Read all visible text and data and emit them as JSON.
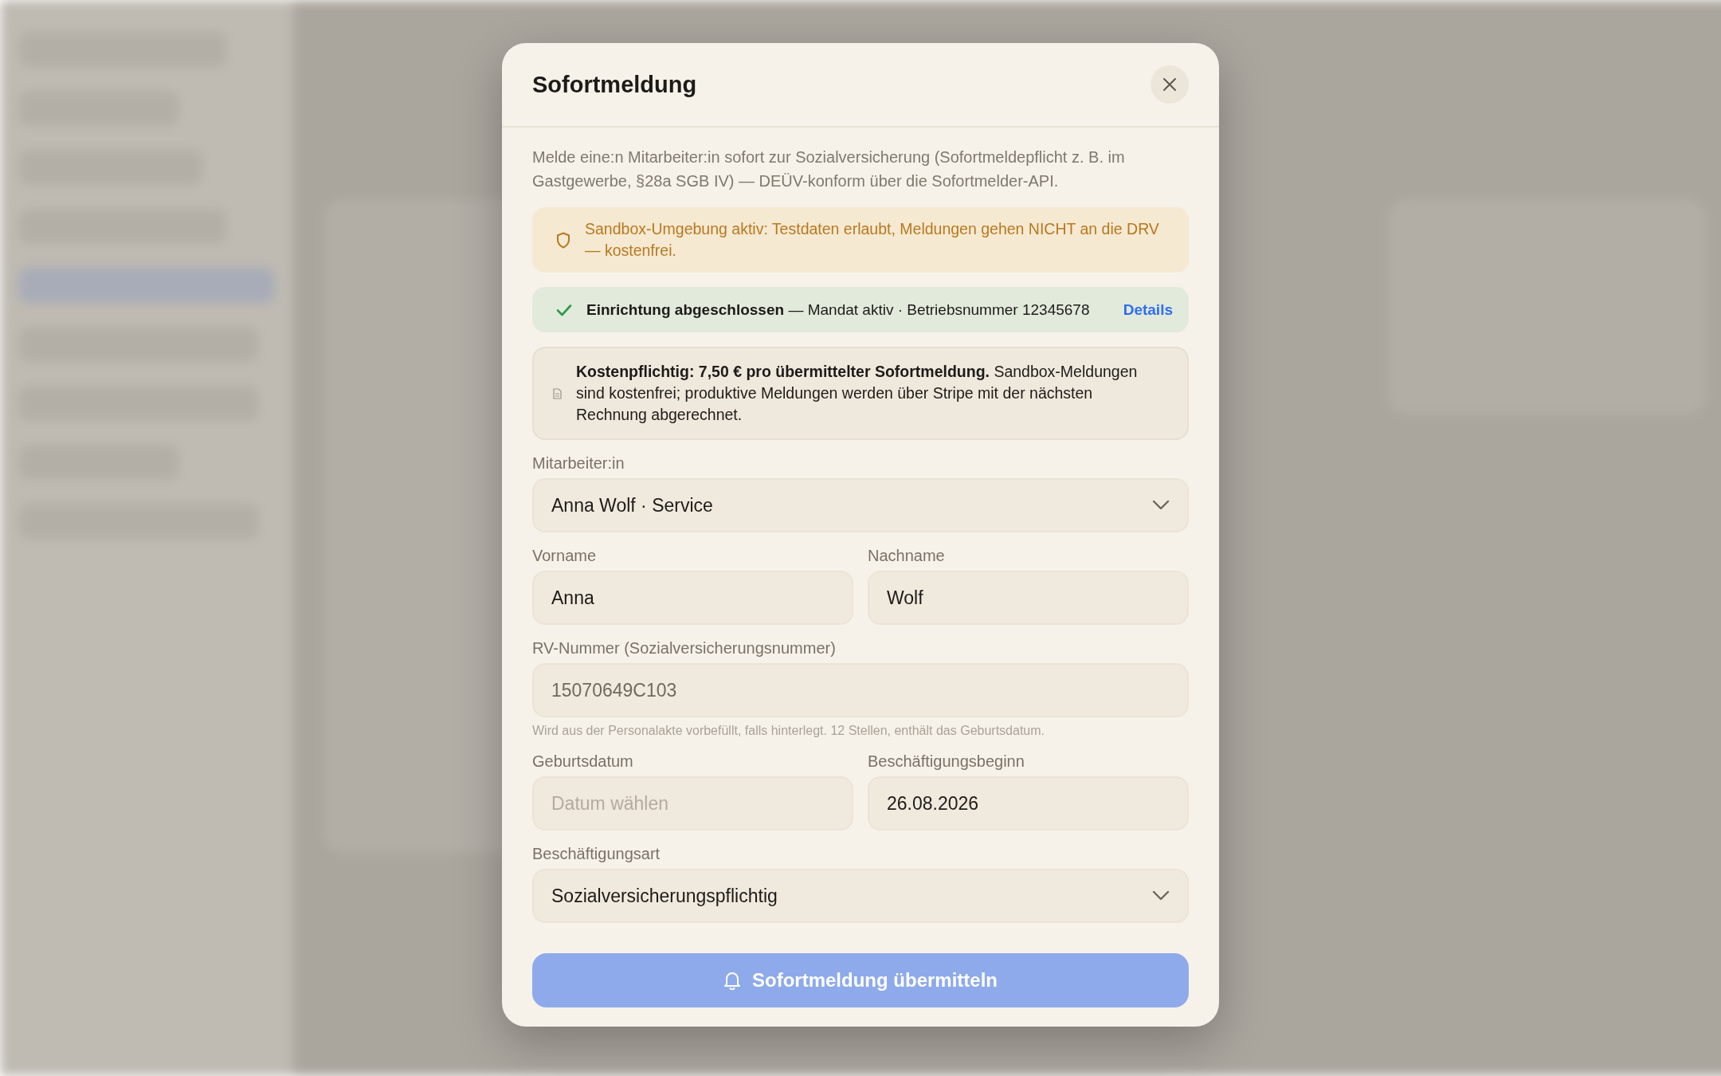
{
  "dialog": {
    "title": "Sofortmeldung",
    "intro": "Melde eine:n Mitarbeiter:in sofort zur Sozialversicherung (Sofortmeldepflicht z. B. im Gastgewerbe, §28a SGB IV) — DEÜV-konform über die Sofortmelder-API.",
    "notices": [
      {
        "kind": "warning",
        "text": "Sandbox-Umgebung aktiv: Testdaten erlaubt, Meldungen gehen NICHT an die DRV — kostenfrei."
      },
      {
        "kind": "success",
        "text": "**Einrichtung abgeschlossen** — Mandat aktiv · Betriebsnummer 12345678",
        "link": "Details"
      },
      {
        "kind": "info",
        "text": "**Kostenpflichtig: 7,50 € pro übermittelter Sofortmeldung.** Sandbox-Meldungen sind kostenfrei; produktive Meldungen werden über Stripe mit der nächsten Rechnung abgerechnet."
      }
    ],
    "form_rows": [
      [
        {
          "kind": "select",
          "label": "Mitarbeiter:in",
          "value": "Anna Wolf · Service"
        }
      ],
      [
        {
          "kind": "input",
          "label": "Vorname",
          "value": "Anna"
        },
        {
          "kind": "input",
          "label": "Nachname",
          "value": "Wolf"
        }
      ],
      [
        {
          "kind": "input",
          "label": "RV-Nummer (Sozialversicherungsnummer)",
          "value": "15070649C103",
          "readonly": true,
          "hint": "Wird aus der Personalakte vorbefüllt, falls hinterlegt. 12 Stellen, enthält das Geburtsdatum."
        }
      ],
      [
        {
          "kind": "input",
          "label": "Geburtsdatum",
          "placeholder": "Datum wählen"
        },
        {
          "kind": "input",
          "label": "Beschäftigungsbeginn",
          "value": "26.08.2026"
        }
      ],
      [
        {
          "kind": "select",
          "label": "Beschäftigungsart",
          "value": "Sozialversicherungspflichtig"
        }
      ]
    ],
    "submit": {
      "label": "Sofortmeldung übermitteln",
      "disabled": true
    }
  }
}
